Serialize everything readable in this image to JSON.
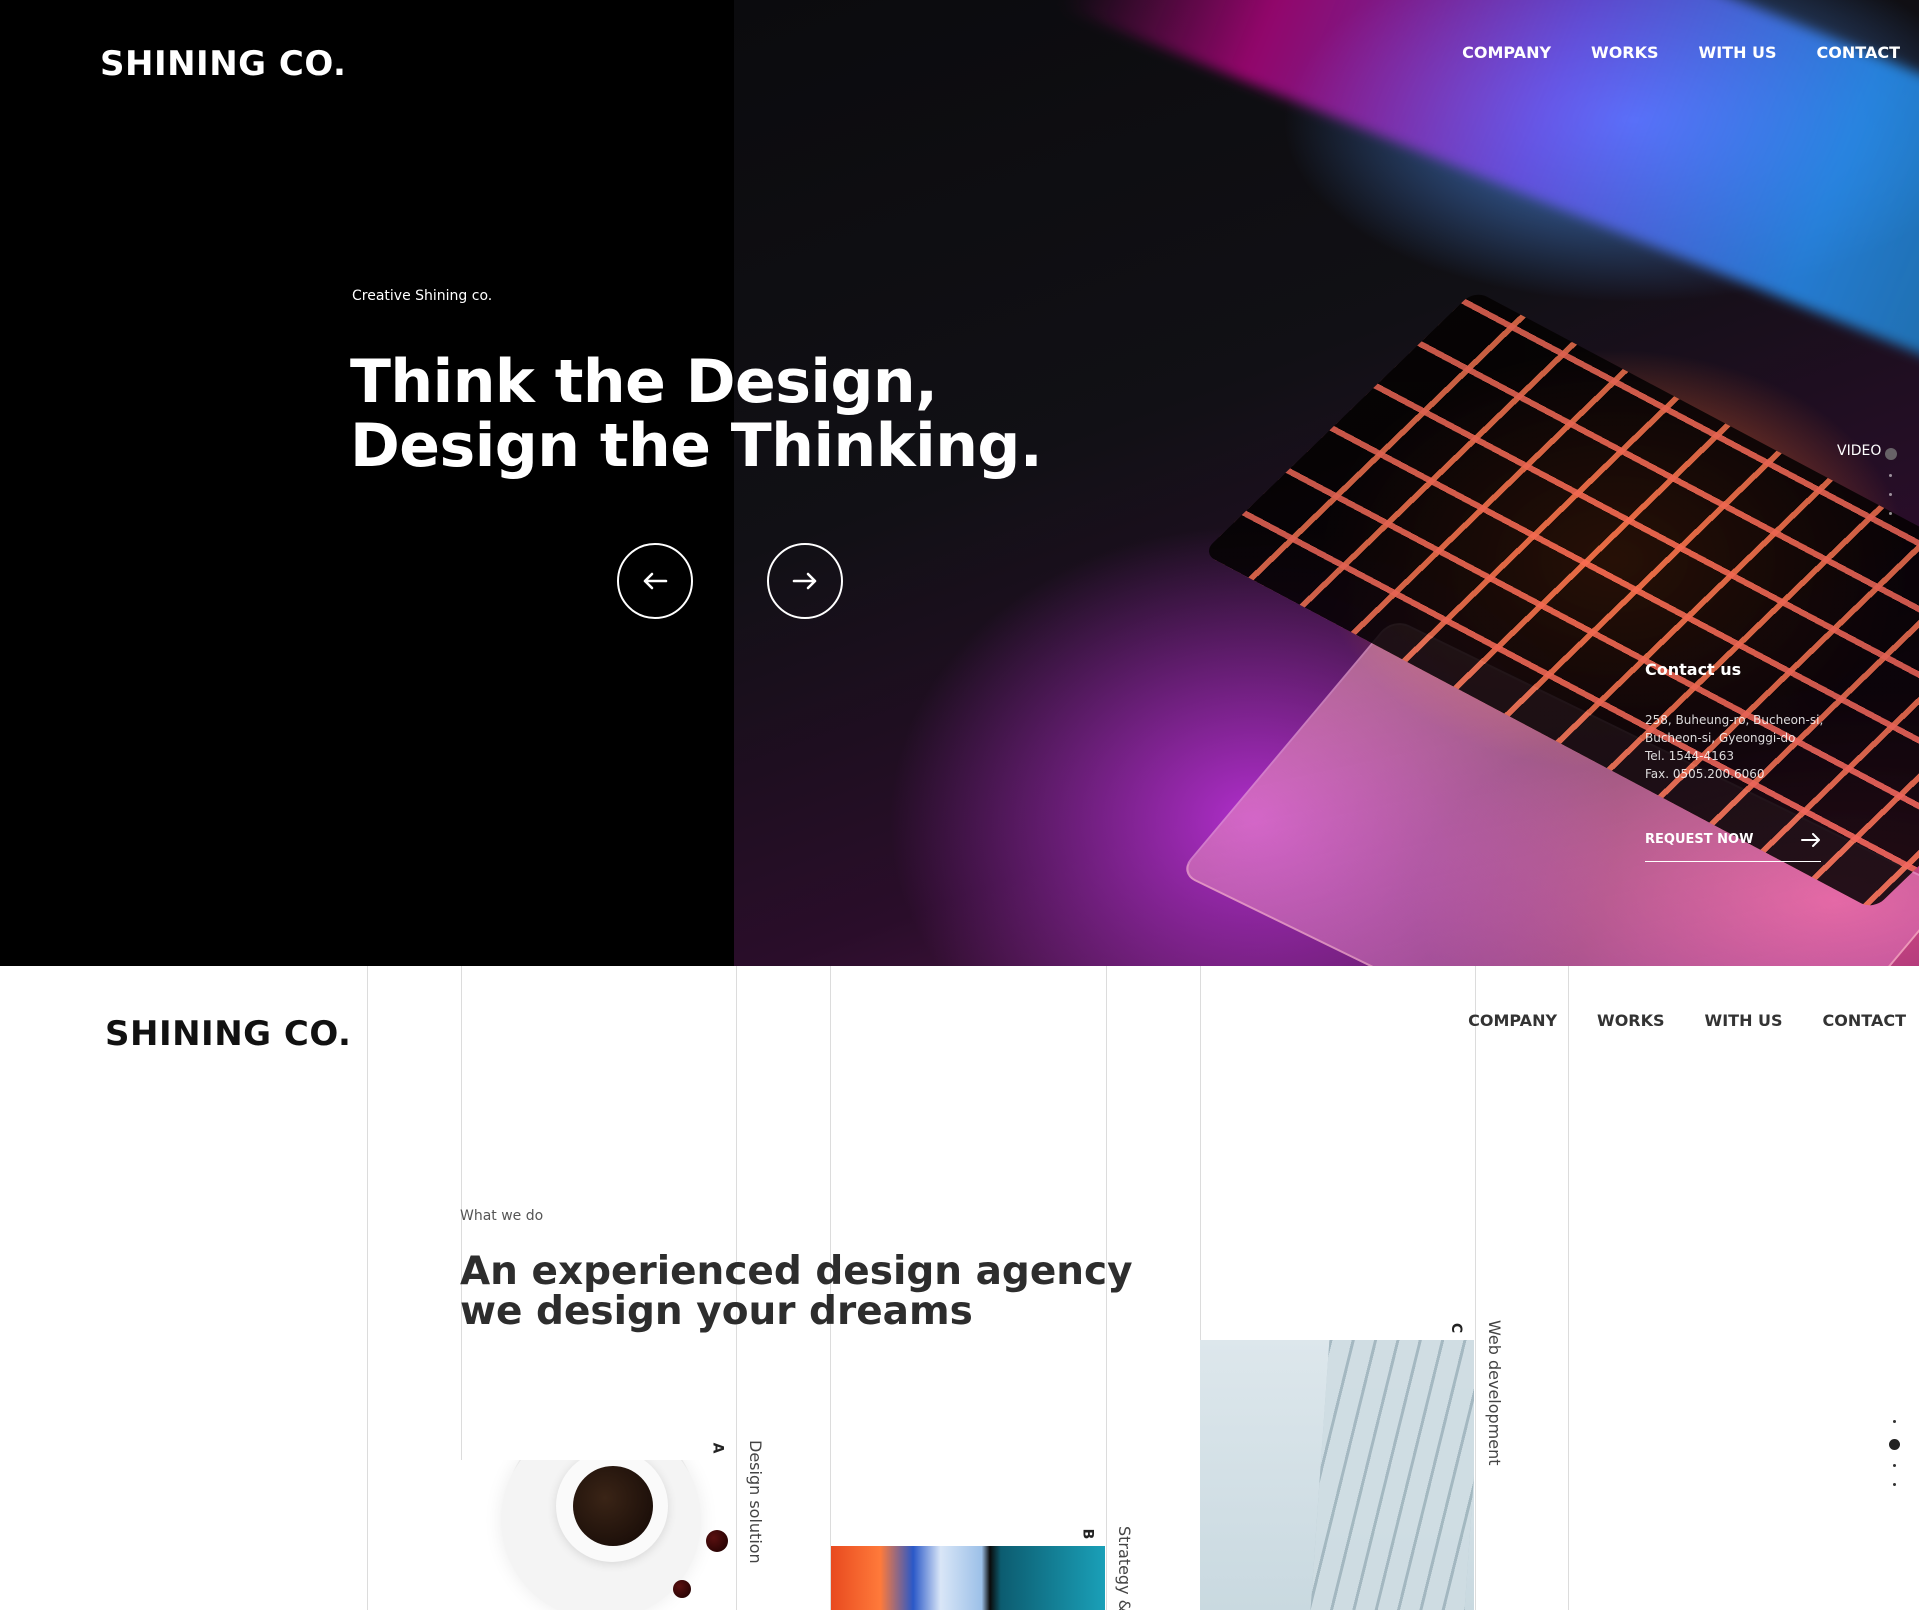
{
  "brand": {
    "name": "SHINING CO."
  },
  "nav": [
    "COMPANY",
    "WORKS",
    "WITH US",
    "CONTACT"
  ],
  "hero": {
    "eyebrow": "Creative Shining co.",
    "headline_line1": "Think the Design,",
    "headline_line2": "Design the Thinking.",
    "video_label": "VIDEO",
    "contact": {
      "title": "Contact us",
      "address1": "258, Buheung-ro, Bucheon-si,",
      "address2": "Bucheon-si, Gyeonggi-do",
      "tel": "Tel. 1544-4163",
      "fax": "Fax. 0505.200.6060"
    },
    "request_label": "REQUEST NOW"
  },
  "services": {
    "eyebrow": "What we do",
    "headline_line1": "An experienced design agency",
    "headline_line2": "we design your dreams",
    "cards": [
      {
        "letter": "A",
        "label": "Design solution"
      },
      {
        "letter": "B",
        "label": "Strategy &"
      },
      {
        "letter": "C",
        "label": "Web development"
      }
    ]
  },
  "icons": {
    "prev": "arrow-left-icon",
    "next": "arrow-right-icon",
    "request": "arrow-right-icon"
  },
  "colors": {
    "hero_bg": "#000000",
    "text_light": "#ffffff",
    "text_dark": "#2d2d2d",
    "grid_line": "#dcdcdc"
  }
}
